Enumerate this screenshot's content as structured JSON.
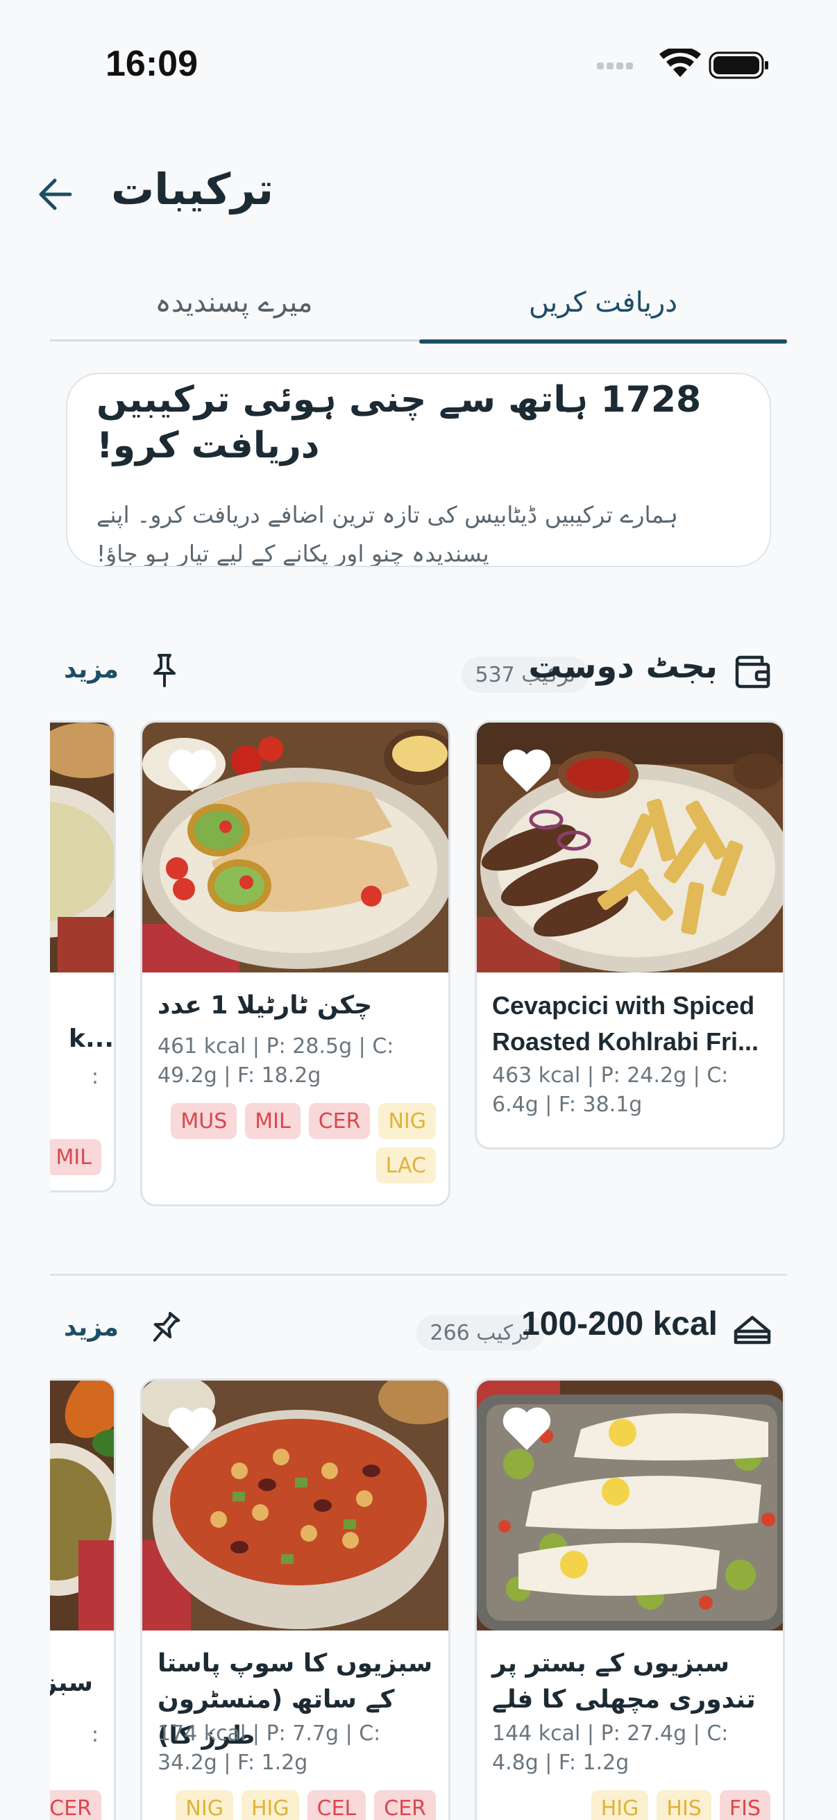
{
  "status_bar": {
    "time": "16:09"
  },
  "header": {
    "title": "ترکیبات"
  },
  "tabs": [
    {
      "label": "میرے پسندیدہ"
    },
    {
      "label": "دریافت کریں"
    }
  ],
  "intro": {
    "title": "1728 ہاتھ سے چنی ہوئی ترکیبیں دریافت کرو!",
    "subtitle": "ہمارے ترکیبیں ڈیٹابیس کی تازہ ترین اضافے دریافت کرو۔ اپنے پسندیدہ چنو اور پکانے کے لیے تیار ہو جاؤ!"
  },
  "sections": [
    {
      "title": "بجٹ دوست",
      "count": "537 ترکیب",
      "more": "مزید",
      "cards": [
        {
          "name": "Cevapcici with Spiced Roasted Kohlrabi Fri...",
          "nutrition": "463 kcal | P: 24.2g | C: 6.4g | F: 38.1g",
          "tags": []
        },
        {
          "name": "چکن ٹارٹیلا 1 عدد",
          "nutrition": "461 kcal | P: 28.5g | C: 49.2g | F: 18.2g",
          "tags": [
            "MUS",
            "MIL",
            "CER",
            "NIG",
            "LAC"
          ]
        },
        {
          "name": "k...",
          "nutrition": ":",
          "tags": [
            "MIL"
          ]
        }
      ]
    },
    {
      "title": "100-200 kcal",
      "count": "266 ترکیب",
      "more": "مزید",
      "cards": [
        {
          "name": "سبزیوں کے بستر پر تندوری مچھلی کا فلے",
          "nutrition": "144 kcal | P: 27.4g | C: 4.8g | F: 1.2g",
          "tags": [
            "HIG",
            "HIS",
            "FIS"
          ]
        },
        {
          "name": "سبزیوں کا سوپ پاستا کے ساتھ (منسٹرون طرز کا)",
          "nutrition": "174 kcal | P: 7.7g | C: 34.2g | F: 1.2g",
          "tags": [
            "NIG",
            "HIG",
            "CEL",
            "CER"
          ]
        },
        {
          "name": "سبز",
          "nutrition": ":",
          "tags": [
            "CER"
          ]
        }
      ]
    }
  ]
}
